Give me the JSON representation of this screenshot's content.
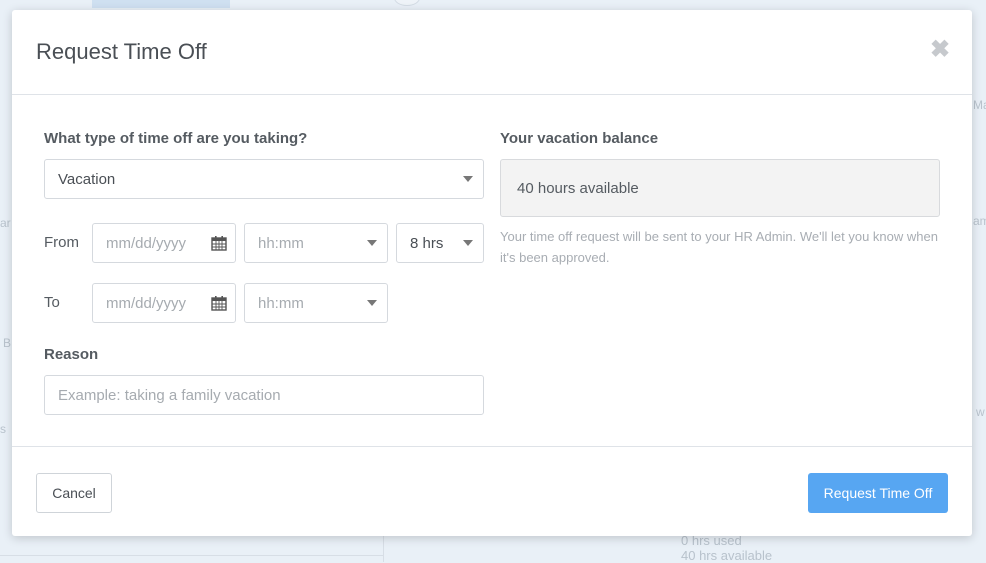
{
  "background": {
    "edge_right_1": "Ma",
    "edge_right_2": "am",
    "edge_right_3": "w",
    "edge_left_1": "ar",
    "edge_left_2": "B",
    "edge_left_3": "s",
    "usage_used": "0 hrs used",
    "usage_available": "40 hrs available"
  },
  "modal": {
    "title": "Request Time Off",
    "close_icon": "close-icon"
  },
  "form": {
    "type_label": "What type of time off are you taking?",
    "type_value": "Vacation",
    "from_label": "From",
    "from_date_placeholder": "mm/dd/yyyy",
    "from_time_placeholder": "hh:mm",
    "hours_value": "8 hrs",
    "to_label": "To",
    "to_date_placeholder": "mm/dd/yyyy",
    "to_time_placeholder": "hh:mm",
    "reason_label": "Reason",
    "reason_placeholder": "Example: taking a family vacation"
  },
  "balance": {
    "label": "Your vacation balance",
    "value": "40 hours available",
    "note": "Your time off request will be sent to your HR Admin. We'll let you know when it's been approved."
  },
  "footer": {
    "cancel_label": "Cancel",
    "submit_label": "Request Time Off"
  },
  "colors": {
    "primary": "#57a6f2",
    "overlay_bg": "#e9f0f7"
  }
}
